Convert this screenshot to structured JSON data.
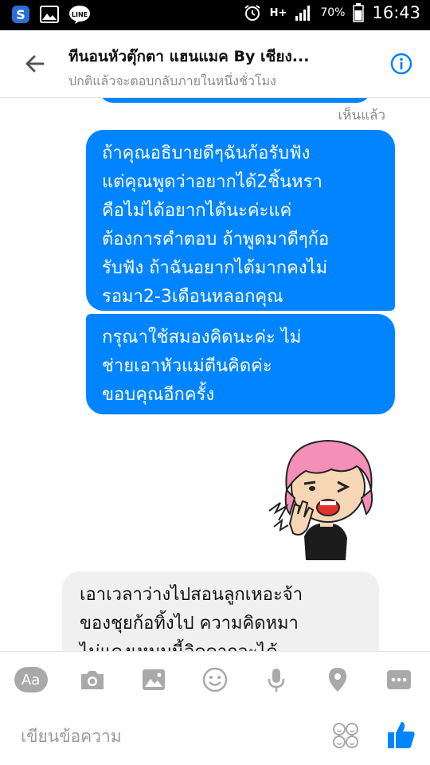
{
  "status_bar": {
    "network": "H+",
    "battery": "70%",
    "time": "16:43"
  },
  "header": {
    "title": "ทีนอนหัวตุ๊กตา แฮนแมค By เชียง...",
    "subtitle": "ปกติแล้วจะตอบกลับภายในหนึ่งชั่วโมง"
  },
  "chat": {
    "seen_label": "เห็นแล้ว",
    "messages": [
      {
        "direction": "outgoing",
        "lines": [
          "ถ้าคุณอธิบายดีๆฉันก้อรับฟัง",
          "แต่คุณพูดว่าอยากได้2ชิ้นหรา",
          "คือไม่ได้อยากได้นะค่ะแค่",
          "ต้องการคำตอบ ถ้าพูดมาดีๆก้อ",
          "รับฟัง ถ้าฉันอยากได้มากคงไม่",
          "รอมา2-3เดือนหลอกคุณ"
        ]
      },
      {
        "direction": "outgoing",
        "lines": [
          "กรุณาใช้สมองคิดนะค่ะ ไม่",
          "ช่ายเอาหัวแม่ตีนคิดค่ะ",
          "ขอบคุณอีกครั้ง"
        ]
      },
      {
        "direction": "incoming",
        "lines": [
          "เอาเวลาว่างไปสอนลูกเหอะจ้า",
          "ของชุยก้อทิ้งไป ความคิดหมา",
          "ไม่แดงเหมมนี้ลิดดากจะได้"
        ]
      }
    ],
    "sticker_icon": "angry-girl-sticker"
  },
  "toolbar": {
    "aa_label": "Aa",
    "icons": [
      "camera-icon",
      "gallery-icon",
      "emoji-icon",
      "microphone-icon",
      "location-icon",
      "more-icon"
    ]
  },
  "composer": {
    "placeholder": "เขียนข้อความ"
  },
  "colors": {
    "messenger_blue": "#0084ff",
    "incoming_bubble": "#f1f0f0",
    "toolbar_icon": "#b0b0b0"
  }
}
